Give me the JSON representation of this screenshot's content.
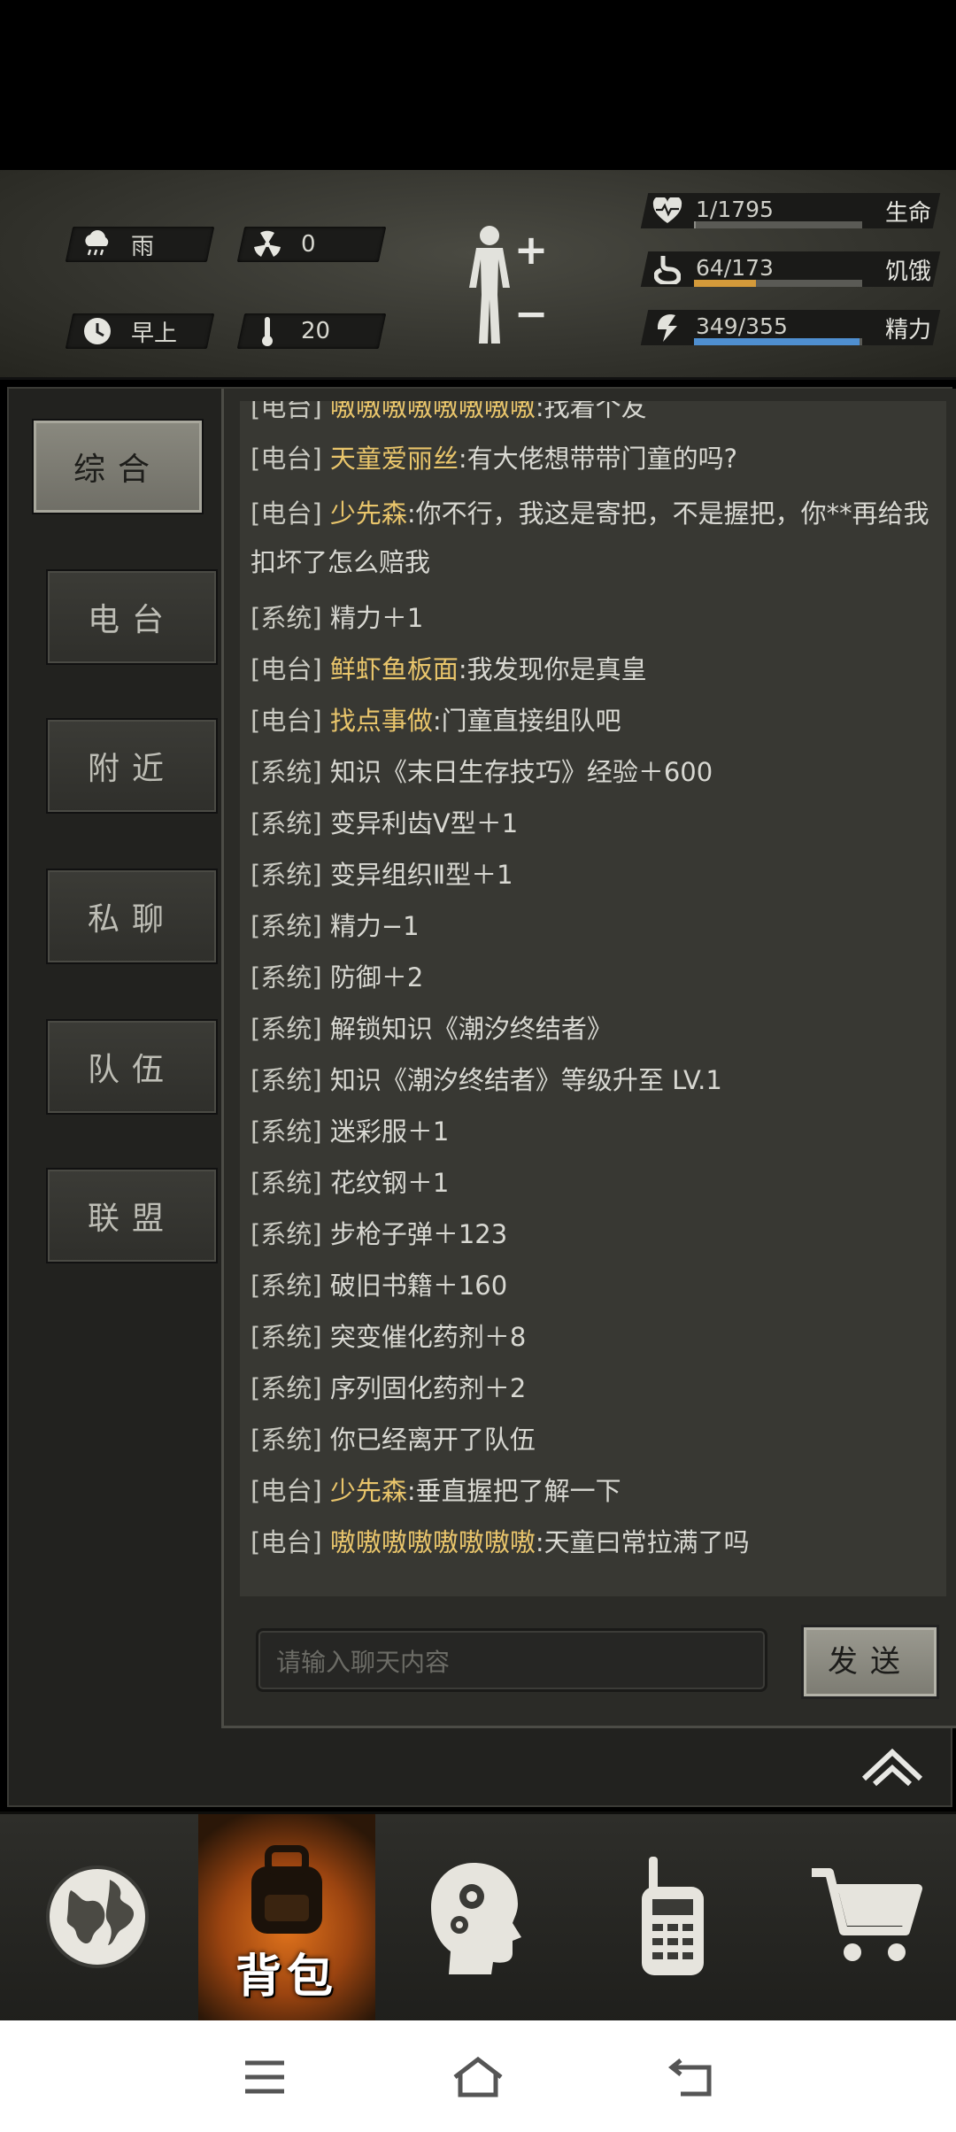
{
  "weather": {
    "icon": "rain-cloud-icon",
    "label": "雨"
  },
  "radiation": {
    "icon": "radiation-icon",
    "value": "0"
  },
  "time": {
    "icon": "clock-icon",
    "label": "早上"
  },
  "temperature": {
    "icon": "thermometer-icon",
    "value": "20"
  },
  "body": {
    "icon": "human-figure-icon",
    "plus": "+",
    "minus": "−"
  },
  "stats": [
    {
      "icon": "heart-pulse-icon",
      "value": "1/1795",
      "label": "生命",
      "fraction": 0.0006,
      "color": "#8c8c86"
    },
    {
      "icon": "stomach-icon",
      "value": "64/173",
      "label": "饥饿",
      "fraction": 0.37,
      "color": "#d49a3a"
    },
    {
      "icon": "energy-icon",
      "value": "349/355",
      "label": "精力",
      "fraction": 0.983,
      "color": "#4f8fd0"
    }
  ],
  "tabs": [
    "综合",
    "电台",
    "附近",
    "私聊",
    "队伍",
    "联盟"
  ],
  "messages": [
    {
      "tag": "[电台]",
      "sender": "嗷嗷嗷嗷嗷嗷嗷嗷",
      "text": ":找着个友"
    },
    {
      "tag": "[电台]",
      "sender": "天童爱丽丝",
      "text": ":有大佬想带带门童的吗?"
    },
    {
      "tag": "[电台]",
      "sender": "少先森",
      "text": ":你不行，我这是寄把，不是握把，你**再给我扣坏了怎么赔我"
    },
    {
      "tag": "[系统]",
      "sender": "",
      "text": "精力＋1"
    },
    {
      "tag": "[电台]",
      "sender": "鲜虾鱼板面",
      "text": ":我发现你是真皇"
    },
    {
      "tag": "[电台]",
      "sender": "找点事做",
      "text": ":门童直接组队吧"
    },
    {
      "tag": "[系统]",
      "sender": "",
      "text": "知识《末日生存技巧》经验＋600"
    },
    {
      "tag": "[系统]",
      "sender": "",
      "text": "变异利齿Ⅴ型＋1"
    },
    {
      "tag": "[系统]",
      "sender": "",
      "text": "变异组织Ⅱ型＋1"
    },
    {
      "tag": "[系统]",
      "sender": "",
      "text": "精力−1"
    },
    {
      "tag": "[系统]",
      "sender": "",
      "text": "防御＋2"
    },
    {
      "tag": "[系统]",
      "sender": "",
      "text": "解锁知识《潮汐终结者》"
    },
    {
      "tag": "[系统]",
      "sender": "",
      "text": "知识《潮汐终结者》等级升至 LV.1"
    },
    {
      "tag": "[系统]",
      "sender": "",
      "text": "迷彩服＋1"
    },
    {
      "tag": "[系统]",
      "sender": "",
      "text": "花纹钢＋1"
    },
    {
      "tag": "[系统]",
      "sender": "",
      "text": "步枪子弹＋123"
    },
    {
      "tag": "[系统]",
      "sender": "",
      "text": "破旧书籍＋160"
    },
    {
      "tag": "[系统]",
      "sender": "",
      "text": "突变催化药剂＋8"
    },
    {
      "tag": "[系统]",
      "sender": "",
      "text": "序列固化药剂＋2"
    },
    {
      "tag": "[系统]",
      "sender": "",
      "text": "你已经离开了队伍"
    },
    {
      "tag": "[电台]",
      "sender": "少先森",
      "text": ":垂直握把了解一下"
    },
    {
      "tag": "[电台]",
      "sender": "嗷嗷嗷嗷嗷嗷嗷嗷",
      "text": ":天童曰常拉满了吗"
    }
  ],
  "chat_input": {
    "placeholder": "请输入聊天内容"
  },
  "send_label": "发送",
  "collapse": {
    "icon": "double-chevron-up-icon"
  },
  "bottom_nav": [
    {
      "icon": "globe-icon",
      "label": ""
    },
    {
      "icon": "backpack-icon",
      "label": "背包"
    },
    {
      "icon": "head-gears-icon",
      "label": ""
    },
    {
      "icon": "walkie-talkie-icon",
      "label": ""
    },
    {
      "icon": "shopping-cart-icon",
      "label": ""
    }
  ],
  "system_nav": [
    {
      "icon": "menu-icon"
    },
    {
      "icon": "home-icon"
    },
    {
      "icon": "back-icon"
    }
  ]
}
